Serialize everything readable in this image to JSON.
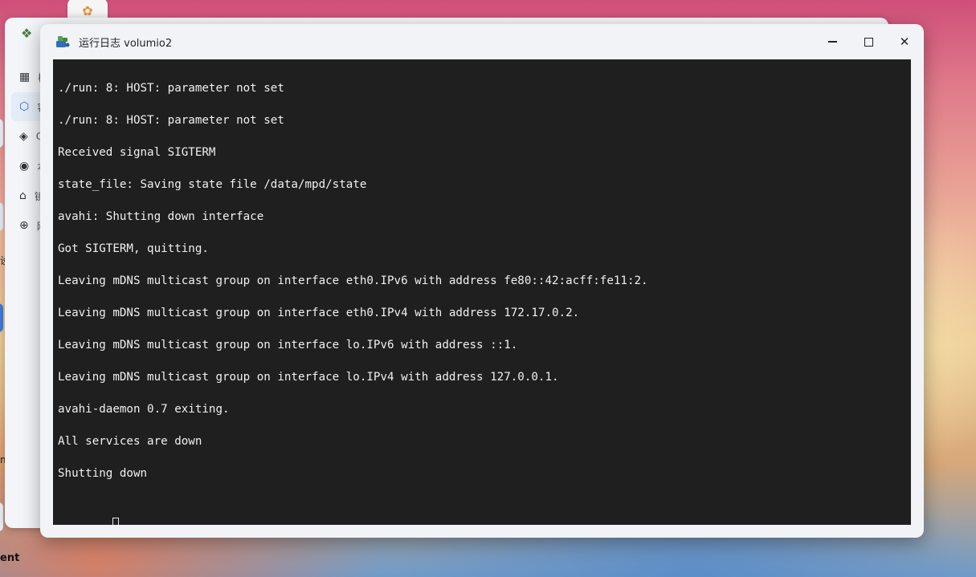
{
  "desktop": {
    "bottom_label": "ent",
    "edge_marks": [
      "设",
      "m"
    ]
  },
  "background_window": {
    "sidebar_items": [
      {
        "icon": "grid-icon",
        "label": "概"
      },
      {
        "icon": "cube-icon",
        "label": "容"
      },
      {
        "icon": "layers-icon",
        "label": "C"
      },
      {
        "icon": "eye-icon",
        "label": "本"
      },
      {
        "icon": "home-icon",
        "label": "镜"
      },
      {
        "icon": "globe-icon",
        "label": "网"
      }
    ]
  },
  "window": {
    "title": "运行日志 volumio2"
  },
  "log": {
    "lines": [
      "./run: 8: HOST: parameter not set",
      "./run: 8: HOST: parameter not set",
      "Received signal SIGTERM",
      "state_file: Saving state file /data/mpd/state",
      "avahi: Shutting down interface",
      "Got SIGTERM, quitting.",
      "Leaving mDNS multicast group on interface eth0.IPv6 with address fe80::42:acff:fe11:2.",
      "Leaving mDNS multicast group on interface eth0.IPv4 with address 172.17.0.2.",
      "Leaving mDNS multicast group on interface lo.IPv6 with address ::1.",
      "Leaving mDNS multicast group on interface lo.IPv4 with address 127.0.0.1.",
      "avahi-daemon 0.7 exiting.",
      "All services are down",
      "Shutting down"
    ]
  },
  "colors": {
    "terminal_bg": "#1f1f1f",
    "terminal_fg": "#f0f0f0",
    "accent": "#1e6fd8"
  }
}
